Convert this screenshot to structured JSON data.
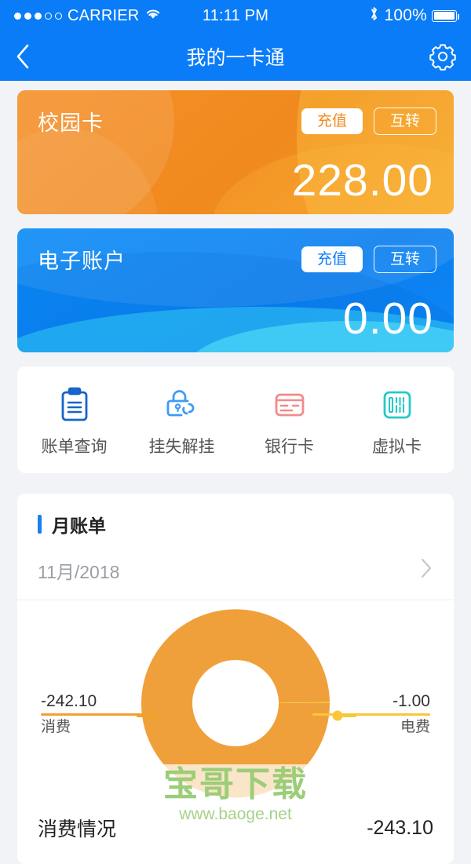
{
  "status_bar": {
    "signal_dots_filled": 3,
    "signal_dots_total": 5,
    "carrier": "CARRIER",
    "wifi_icon": "wifi-icon",
    "time": "11:11 PM",
    "bluetooth_icon": "bluetooth-icon",
    "battery_percent": "100%"
  },
  "navbar": {
    "back_icon": "chevron-left-icon",
    "title": "我的一卡通",
    "settings_icon": "gear-icon"
  },
  "cards": [
    {
      "id": "campus-card",
      "name": "校园卡",
      "amount": "228.00",
      "recharge_label": "充值",
      "transfer_label": "互转",
      "color": "#f0901f"
    },
    {
      "id": "e-account",
      "name": "电子账户",
      "amount": "0.00",
      "recharge_label": "充值",
      "transfer_label": "互转",
      "color": "#0b84f5"
    }
  ],
  "quick_actions": [
    {
      "label": "账单查询",
      "icon": "clipboard-icon",
      "color": "#1565c8"
    },
    {
      "label": "挂失解挂",
      "icon": "lock-link-icon",
      "color": "#3f9bf5"
    },
    {
      "label": "银行卡",
      "icon": "bank-card-icon",
      "color": "#f28b8b"
    },
    {
      "label": "虚拟卡",
      "icon": "barcode-card-icon",
      "color": "#28c8c8"
    }
  ],
  "bill": {
    "section_title": "月账单",
    "month": "11月/2018",
    "chevron_icon": "chevron-right-icon",
    "total_label": "消费情况",
    "total_value": "-243.10"
  },
  "chart_data": {
    "type": "pie",
    "title": "月账单",
    "subtitle": "11月/2018",
    "donut": true,
    "inner_radius_ratio": 0.46,
    "categories": [
      "消费",
      "电费"
    ],
    "values": [
      -242.1,
      -1.0
    ],
    "labels": [
      "-242.10",
      "-1.00"
    ],
    "colors": [
      "#f0a03a",
      "#fac63a"
    ],
    "total": -243.1,
    "total_label": "消费情况",
    "legend_position": "callout-leader-lines",
    "annotations": [
      {
        "side": "left",
        "value": "-242.10",
        "name": "消费",
        "color": "#efa22e"
      },
      {
        "side": "right",
        "value": "-1.00",
        "name": "电费",
        "color": "#fac63a"
      }
    ]
  },
  "watermark": {
    "main": "宝哥下载",
    "sub": "www.baoge.net",
    "color": "#9ccd78"
  }
}
